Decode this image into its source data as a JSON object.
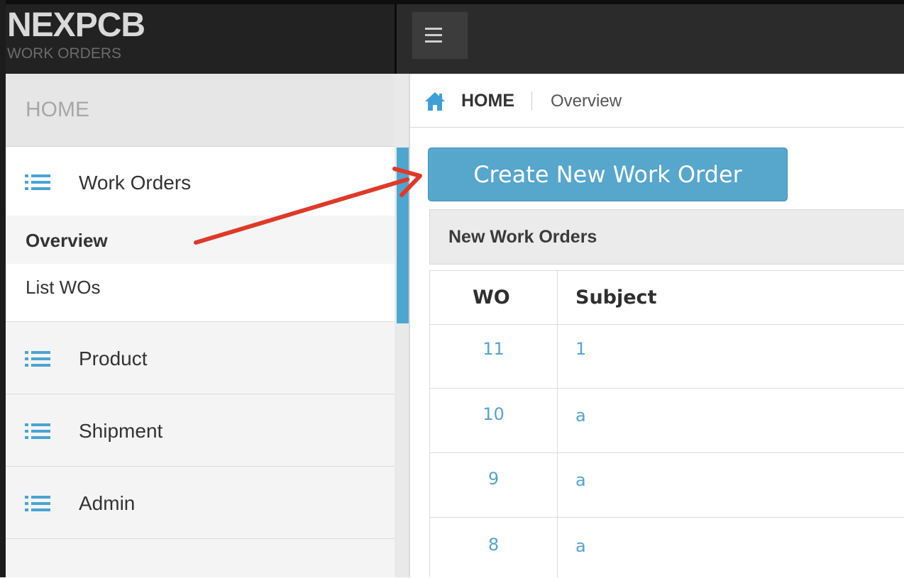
{
  "brand": {
    "title": "NEXPCB",
    "subtitle": "WORK ORDERS"
  },
  "navbar": {
    "menu_toggle_icon": "hamburger-icon"
  },
  "sidebar": {
    "home_label": "HOME",
    "sections": [
      {
        "label": "Work Orders",
        "icon": "list-icon",
        "expanded": true
      },
      {
        "label": "Product",
        "icon": "list-icon"
      },
      {
        "label": "Shipment",
        "icon": "list-icon"
      },
      {
        "label": "Admin",
        "icon": "list-icon"
      }
    ],
    "work_orders_sub": [
      {
        "label": "Overview",
        "active": true
      },
      {
        "label": "List WOs"
      }
    ]
  },
  "breadcrumb": {
    "home_icon": "home-icon",
    "home": "HOME",
    "current": "Overview"
  },
  "main": {
    "create_button_label": "Create New Work Order",
    "panel_title": "New Work Orders",
    "table": {
      "headers": [
        "WO",
        "Subject"
      ],
      "rows": [
        {
          "wo": "11",
          "subject": "1"
        },
        {
          "wo": "10",
          "subject": "a"
        },
        {
          "wo": "9",
          "subject": "a"
        },
        {
          "wo": "8",
          "subject": "a"
        }
      ]
    }
  },
  "colors": {
    "accent": "#57a6cc",
    "link": "#56a3cc",
    "dark_bar": "#2b2b2b",
    "annotation_arrow": "#e0392b"
  }
}
